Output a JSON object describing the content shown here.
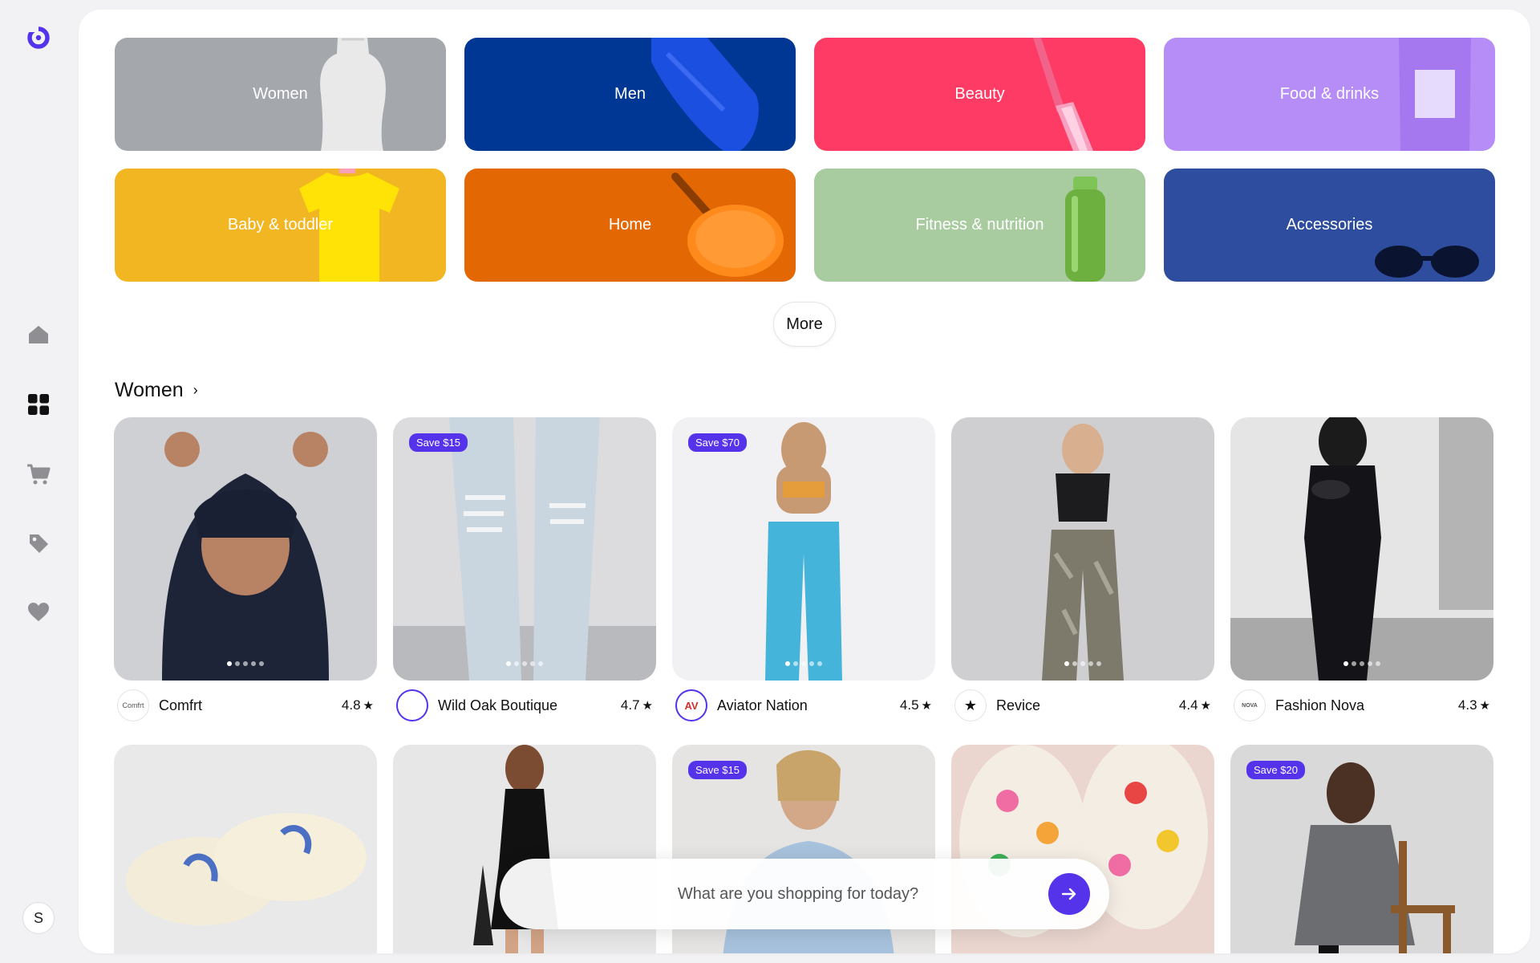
{
  "sidebar": {
    "logo": "shop-logo-icon",
    "items": [
      {
        "name": "home-icon"
      },
      {
        "name": "categories-icon"
      },
      {
        "name": "cart-icon"
      },
      {
        "name": "tag-icon"
      },
      {
        "name": "heart-icon"
      }
    ],
    "avatar_initial": "S"
  },
  "categories": [
    {
      "label": "Women",
      "bg": "#a4a8ad"
    },
    {
      "label": "Men",
      "bg": "#003694"
    },
    {
      "label": "Beauty",
      "bg": "#fd3b64"
    },
    {
      "label": "Food & drinks",
      "bg": "#b68df7"
    },
    {
      "label": "Baby & toddler",
      "bg": "#f2b623"
    },
    {
      "label": "Home",
      "bg": "#e36803"
    },
    {
      "label": "Fitness & nutrition",
      "bg": "#a8cba0"
    },
    {
      "label": "Accessories",
      "bg": "#2e4d9e"
    }
  ],
  "more_label": "More",
  "section": {
    "title": "Women",
    "chevron": "chevron-right-icon"
  },
  "products": [
    {
      "shop": "Comfrt",
      "logo_text": "Comfrt",
      "rating": "4.8",
      "badge": ""
    },
    {
      "shop": "Wild Oak Boutique",
      "logo_text": "",
      "rating": "4.7",
      "badge": "Save $15"
    },
    {
      "shop": "Aviator Nation",
      "logo_text": "AV",
      "rating": "4.5",
      "badge": "Save $70"
    },
    {
      "shop": "Revice",
      "logo_text": "★",
      "rating": "4.4",
      "badge": ""
    },
    {
      "shop": "Fashion Nova",
      "logo_text": "NOVA",
      "rating": "4.3",
      "badge": ""
    },
    {
      "shop": "",
      "logo_text": "",
      "rating": "",
      "badge": ""
    },
    {
      "shop": "",
      "logo_text": "",
      "rating": "",
      "badge": ""
    },
    {
      "shop": "",
      "logo_text": "",
      "rating": "",
      "badge": "Save $15"
    },
    {
      "shop": "",
      "logo_text": "",
      "rating": "",
      "badge": ""
    },
    {
      "shop": "",
      "logo_text": "",
      "rating": "",
      "badge": "Save $20"
    }
  ],
  "search": {
    "placeholder": "What are you shopping for today?"
  },
  "colors": {
    "accent": "#5433eb"
  }
}
